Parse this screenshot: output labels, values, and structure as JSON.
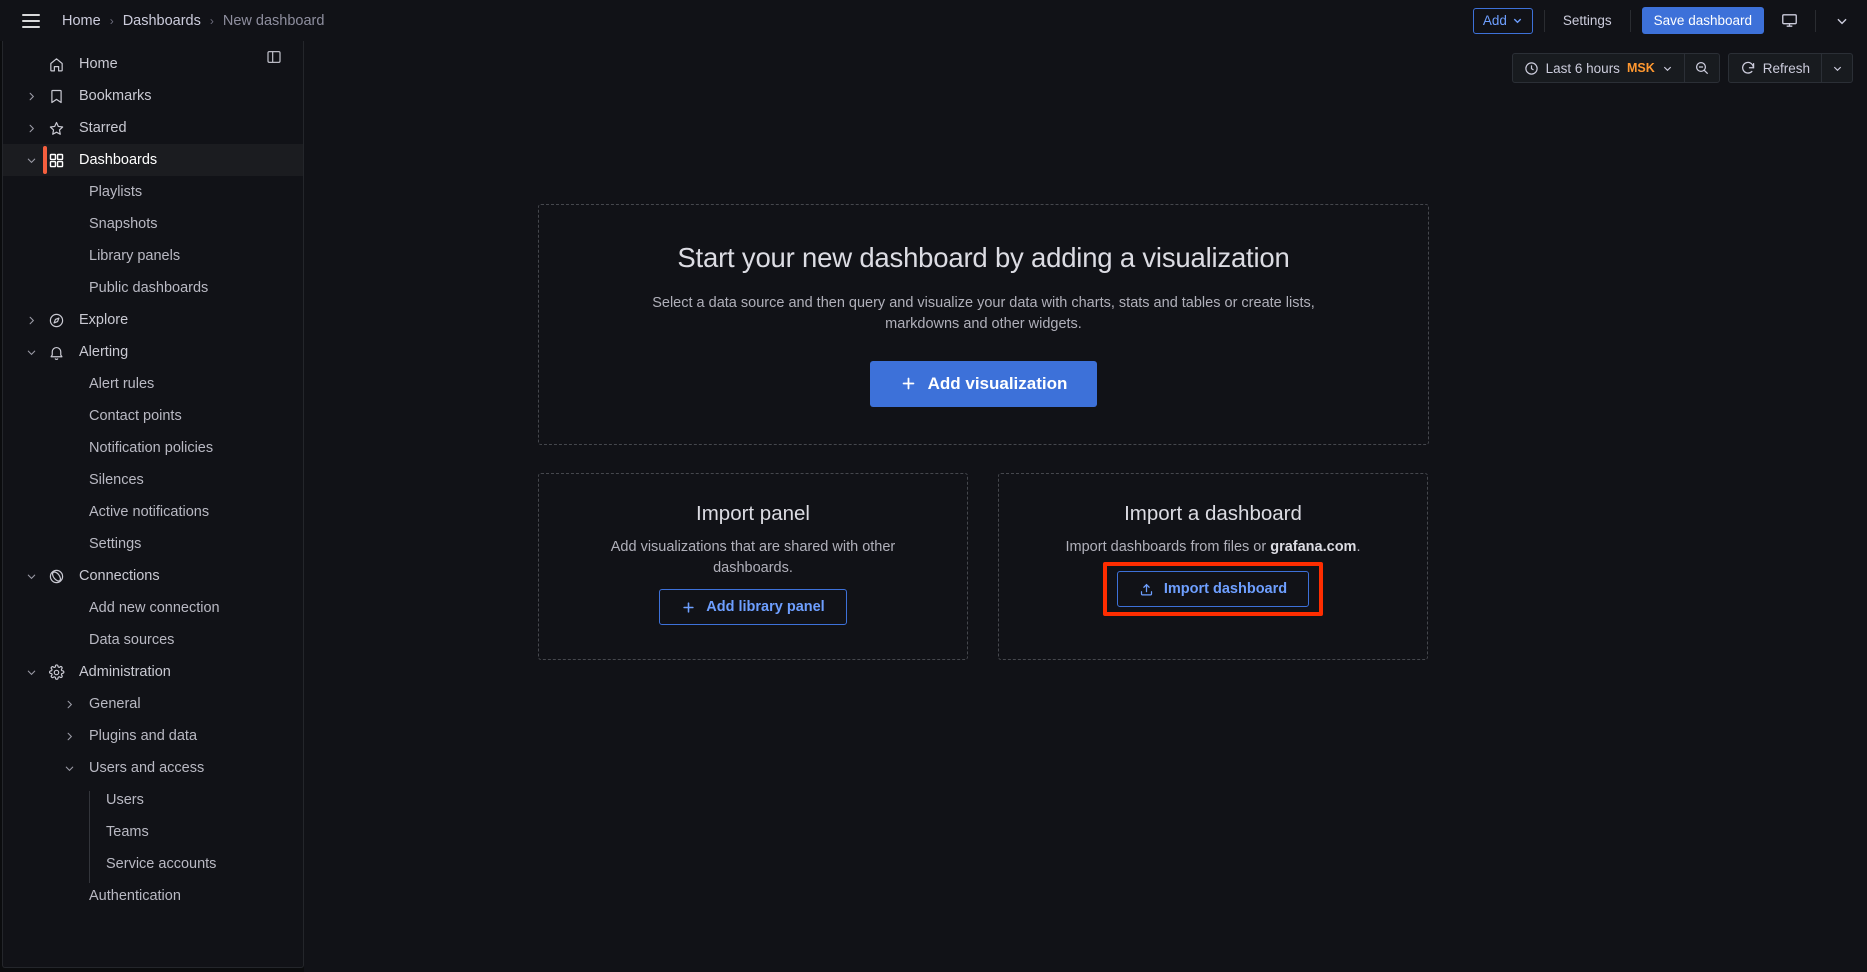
{
  "topbar": {
    "menu_icon": "hamburger-menu-icon",
    "breadcrumb": [
      {
        "label": "Home",
        "current": false
      },
      {
        "label": "Dashboards",
        "current": false
      },
      {
        "label": "New dashboard",
        "current": true
      }
    ],
    "separator": "›",
    "add_label": "Add",
    "settings_label": "Settings",
    "save_label": "Save dashboard",
    "tv_icon": "monitor-icon",
    "more_icon": "chevron-down-icon"
  },
  "timebar": {
    "clock_icon": "clock-icon",
    "range_label": "Last 6 hours",
    "timezone": "MSK",
    "caret_icon": "chevron-down-icon",
    "zoom_out_icon": "zoom-out-icon",
    "refresh_icon": "refresh-icon",
    "refresh_label": "Refresh",
    "refresh_caret_icon": "chevron-down-icon"
  },
  "sidebar": {
    "dock_icon": "dock-menu-icon",
    "items": [
      {
        "label": "Home",
        "icon": "home-icon",
        "level": 1,
        "chevron": "none",
        "active": false
      },
      {
        "label": "Bookmarks",
        "icon": "bookmark-icon",
        "level": 1,
        "chevron": "right",
        "active": false
      },
      {
        "label": "Starred",
        "icon": "star-icon",
        "level": 1,
        "chevron": "right",
        "active": false
      },
      {
        "label": "Dashboards",
        "icon": "apps-grid-icon",
        "level": 1,
        "chevron": "down",
        "active": true
      },
      {
        "label": "Playlists",
        "icon": "",
        "level": 2,
        "chevron": "none",
        "active": false
      },
      {
        "label": "Snapshots",
        "icon": "",
        "level": 2,
        "chevron": "none",
        "active": false
      },
      {
        "label": "Library panels",
        "icon": "",
        "level": 2,
        "chevron": "none",
        "active": false
      },
      {
        "label": "Public dashboards",
        "icon": "",
        "level": 2,
        "chevron": "none",
        "active": false
      },
      {
        "label": "Explore",
        "icon": "compass-icon",
        "level": 1,
        "chevron": "right",
        "active": false
      },
      {
        "label": "Alerting",
        "icon": "bell-icon",
        "level": 1,
        "chevron": "down",
        "active": false
      },
      {
        "label": "Alert rules",
        "icon": "",
        "level": 2,
        "chevron": "none",
        "active": false
      },
      {
        "label": "Contact points",
        "icon": "",
        "level": 2,
        "chevron": "none",
        "active": false
      },
      {
        "label": "Notification policies",
        "icon": "",
        "level": 2,
        "chevron": "none",
        "active": false
      },
      {
        "label": "Silences",
        "icon": "",
        "level": 2,
        "chevron": "none",
        "active": false
      },
      {
        "label": "Active notifications",
        "icon": "",
        "level": 2,
        "chevron": "none",
        "active": false
      },
      {
        "label": "Settings",
        "icon": "",
        "level": 2,
        "chevron": "none",
        "active": false
      },
      {
        "label": "Connections",
        "icon": "connections-icon",
        "level": 1,
        "chevron": "down",
        "active": false
      },
      {
        "label": "Add new connection",
        "icon": "",
        "level": 2,
        "chevron": "none",
        "active": false
      },
      {
        "label": "Data sources",
        "icon": "",
        "level": 2,
        "chevron": "none",
        "active": false
      },
      {
        "label": "Administration",
        "icon": "gear-icon",
        "level": 1,
        "chevron": "down",
        "active": false
      },
      {
        "label": "General",
        "icon": "",
        "level": 2,
        "chevron": "right",
        "active": false
      },
      {
        "label": "Plugins and data",
        "icon": "",
        "level": 2,
        "chevron": "right",
        "active": false
      },
      {
        "label": "Users and access",
        "icon": "",
        "level": 2,
        "chevron": "down",
        "active": false
      },
      {
        "label": "Users",
        "icon": "",
        "level": 3,
        "chevron": "none",
        "active": false
      },
      {
        "label": "Teams",
        "icon": "",
        "level": 3,
        "chevron": "none",
        "active": false
      },
      {
        "label": "Service accounts",
        "icon": "",
        "level": 3,
        "chevron": "none",
        "active": false
      },
      {
        "label": "Authentication",
        "icon": "",
        "level": 2,
        "chevron": "none",
        "active": false
      }
    ]
  },
  "hero": {
    "title": "Start your new dashboard by adding a visualization",
    "description": "Select a data source and then query and visualize your data with charts, stats and tables or create lists, markdowns and other widgets.",
    "button_label": "Add visualization",
    "button_icon": "plus-icon"
  },
  "cards": [
    {
      "title": "Import panel",
      "description": "Add visualizations that are shared with other dashboards.",
      "description_bold": "",
      "description_tail": "",
      "button_label": "Add library panel",
      "button_icon": "plus-icon",
      "highlighted": false
    },
    {
      "title": "Import a dashboard",
      "description": "Import dashboards from files or ",
      "description_bold": "grafana.com",
      "description_tail": ".",
      "button_label": "Import dashboard",
      "button_icon": "upload-icon",
      "highlighted": true
    }
  ],
  "colors": {
    "accent_orange": "#f55f3e",
    "primary_blue": "#3d71d9",
    "link_blue": "#6e9fff",
    "timezone_orange": "#ff9830",
    "annotation_red": "#ff2d00",
    "background": "#111217"
  }
}
